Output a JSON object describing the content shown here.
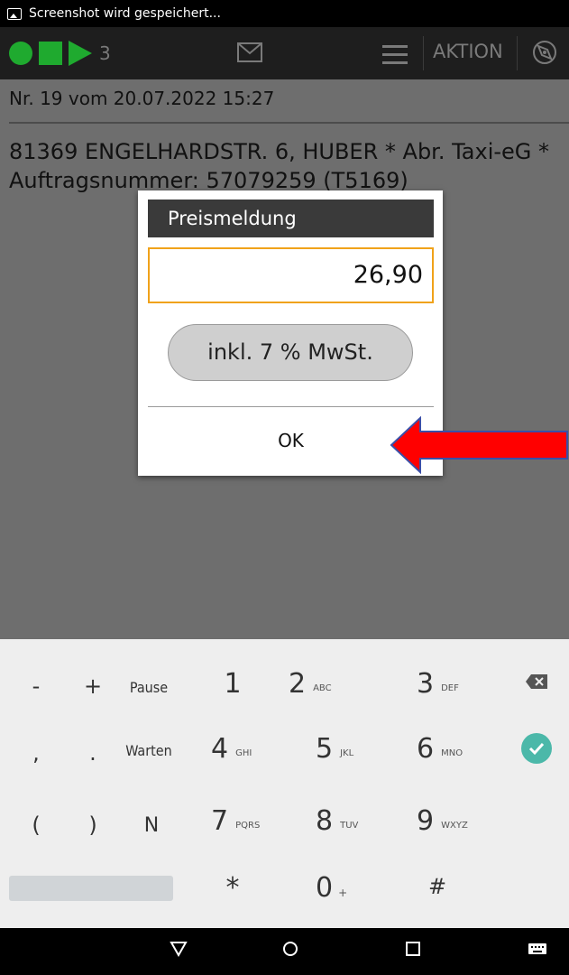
{
  "statusbar": {
    "text": "Screenshot wird gespeichert..."
  },
  "toolbar": {
    "count": "3",
    "aktion": "AKTION"
  },
  "order": {
    "title": "Nr. 19 vom 20.07.2022 15:27",
    "address": "81369 ENGELHARDSTR. 6, HUBER * Abr. Taxi-eG * Auftragsnummer: 57079259 (T5169)"
  },
  "dialog": {
    "title": "Preismeldung",
    "price": "26,90",
    "mwst_label": "inkl. 7 % MwSt.",
    "ok_label": "OK"
  },
  "keyboard": {
    "r1": {
      "a": "-",
      "b": "+",
      "c": "Pause",
      "n1": "1",
      "n2": "2",
      "s2": "ABC",
      "n3": "3",
      "s3": "DEF"
    },
    "r2": {
      "a": ",",
      "b": ".",
      "c": "Warten",
      "n1": "4",
      "s1": "GHI",
      "n2": "5",
      "s2": "JKL",
      "n3": "6",
      "s3": "MNO"
    },
    "r3": {
      "a": "(",
      "b": ")",
      "c": "N",
      "n1": "7",
      "s1": "PQRS",
      "n2": "8",
      "s2": "TUV",
      "n3": "9",
      "s3": "WXYZ"
    },
    "r4": {
      "star": "*",
      "zero": "0",
      "zero_sub": "+",
      "hash": "#"
    }
  },
  "colors": {
    "green": "#1faa2f",
    "accent": "#f0a21a",
    "arrow": "#ff0000",
    "check": "#4bb8a9"
  }
}
